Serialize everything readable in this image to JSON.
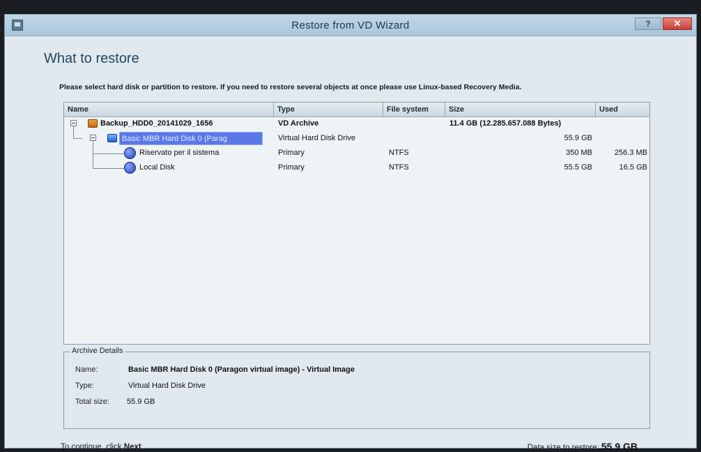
{
  "window": {
    "title": "Restore from VD Wizard",
    "help_label": "?",
    "close_label": "✕"
  },
  "page": {
    "heading": "What to restore",
    "instruction": "Please select hard disk or partition to restore. If you need to restore several objects at once please use Linux-based Recovery Media."
  },
  "table": {
    "columns": [
      "Name",
      "Type",
      "File system",
      "Size",
      "Used"
    ],
    "rows": [
      {
        "name": "Backup_HDD0_20141029_1656",
        "type": "VD Archive",
        "fs": "",
        "size": "11.4 GB (12.285.657.088 Bytes)",
        "used": ""
      },
      {
        "name": "Basic MBR Hard Disk 0 (Parag",
        "type": "Virtual Hard Disk Drive",
        "fs": "",
        "size": "55.9 GB",
        "used": ""
      },
      {
        "name": "Riservato per il sistema",
        "type": "Primary",
        "fs": "NTFS",
        "size": "350 MB",
        "used": "256.3 MB"
      },
      {
        "name": "Local Disk",
        "type": "Primary",
        "fs": "NTFS",
        "size": "55.5 GB",
        "used": "16.5 GB"
      }
    ]
  },
  "details": {
    "legend": "Archive Details",
    "name_label": "Name:",
    "name_value": "Basic MBR Hard Disk 0 (Paragon virtual image) - Virtual Image",
    "type_label": "Type:",
    "type_value": "Virtual Hard Disk Drive",
    "size_label": "Total size:",
    "size_value": "55.9 GB"
  },
  "footer": {
    "continue_prefix": "To continue, click",
    "continue_action": "Next",
    "restore_label": "Data size to restore:",
    "restore_value": "55.9 GB"
  }
}
